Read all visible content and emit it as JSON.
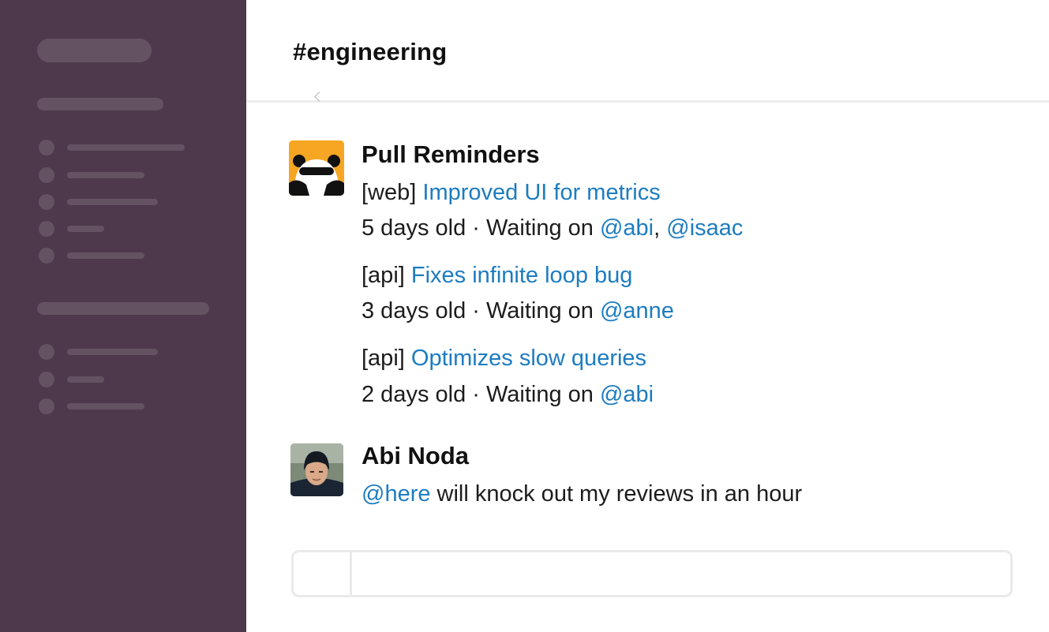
{
  "channel": {
    "name": "#engineering"
  },
  "messages": [
    {
      "sender": "Pull Reminders",
      "avatar_icon": "panda-bot-avatar",
      "avatar_color": "#f7a623",
      "reminders": [
        {
          "repo": "[web]",
          "title": "Improved UI for metrics",
          "age": "5 days old",
          "sep": " · Waiting on ",
          "users": [
            "@abi",
            "@isaac"
          ],
          "comma": ", "
        },
        {
          "repo": "[api]",
          "title": "Fixes infinite loop bug",
          "age": "3 days old",
          "sep": " · Waiting on ",
          "users": [
            "@anne"
          ]
        },
        {
          "repo": "[api]",
          "title": "Optimizes slow queries",
          "age": "2 days old",
          "sep": " · Waiting on ",
          "users": [
            "@abi"
          ]
        }
      ]
    },
    {
      "sender": "Abi Noda",
      "avatar_icon": "user-photo-avatar",
      "mention": "@here",
      "text": " will knock out my reviews in an hour"
    }
  ],
  "colors": {
    "sidebar": "#4d394b",
    "link": "#1d7cc0"
  }
}
